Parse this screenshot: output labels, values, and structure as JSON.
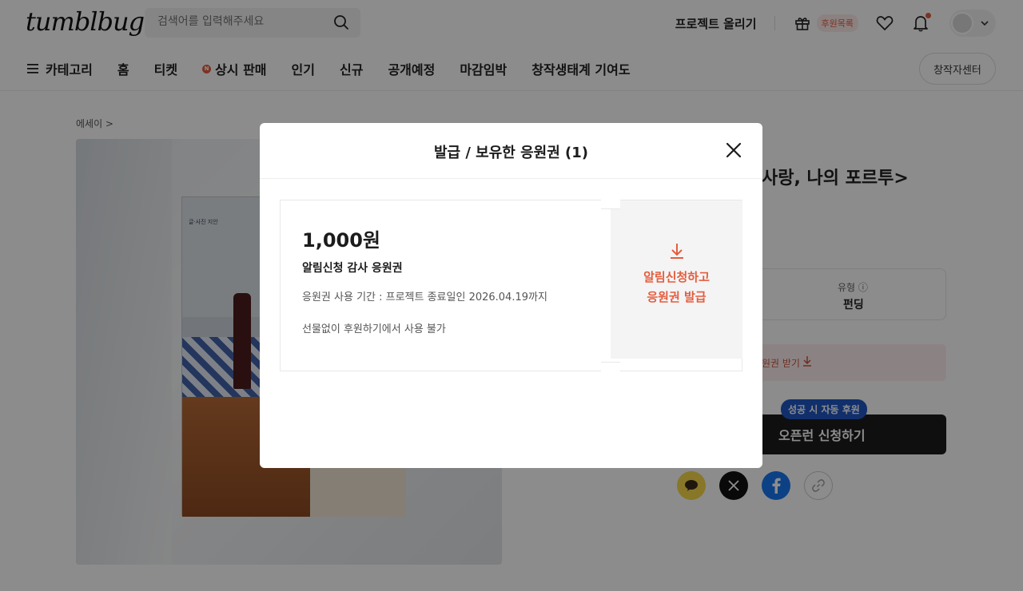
{
  "header": {
    "logo": "tumblbug",
    "search_placeholder": "검색어를 입력해주세요",
    "upload_label": "프로젝트 올리기",
    "orders_badge": "후원목록"
  },
  "nav": {
    "category": "카테고리",
    "items": [
      "홈",
      "티켓",
      "상시 판매",
      "인기",
      "신규",
      "공개예정",
      "마감임박",
      "창작생태계 기여도"
    ],
    "n_badge": "N",
    "creator_center": "창작자센터"
  },
  "page": {
    "breadcrumb": "에세이 >",
    "cover_caption": "글·사진 지안",
    "title_fragment": "사랑, 나의 포르투>",
    "type_label": "유형 ⓘ",
    "type_value": "펀딩",
    "coupon_strip": "원권 받기",
    "auto_badge": "성공 시 자동 후원",
    "cta": "오픈런 신청하기"
  },
  "modal": {
    "title": "발급 / 보유한 응원권 (1)",
    "coupon": {
      "amount": "1,000원",
      "name": "알림신청 감사 응원권",
      "period": "응원권 사용 기간 : 프로젝트 종료일인 2026.04.19까지",
      "note": "선물없이 후원하기에서 사용 불가",
      "action_line1": "알림신청하고",
      "action_line2": "응원권 발급"
    }
  },
  "colors": {
    "accent": "#e45d3f",
    "badge_blue": "#1f57c3",
    "cta_dark": "#1c1c1c"
  }
}
